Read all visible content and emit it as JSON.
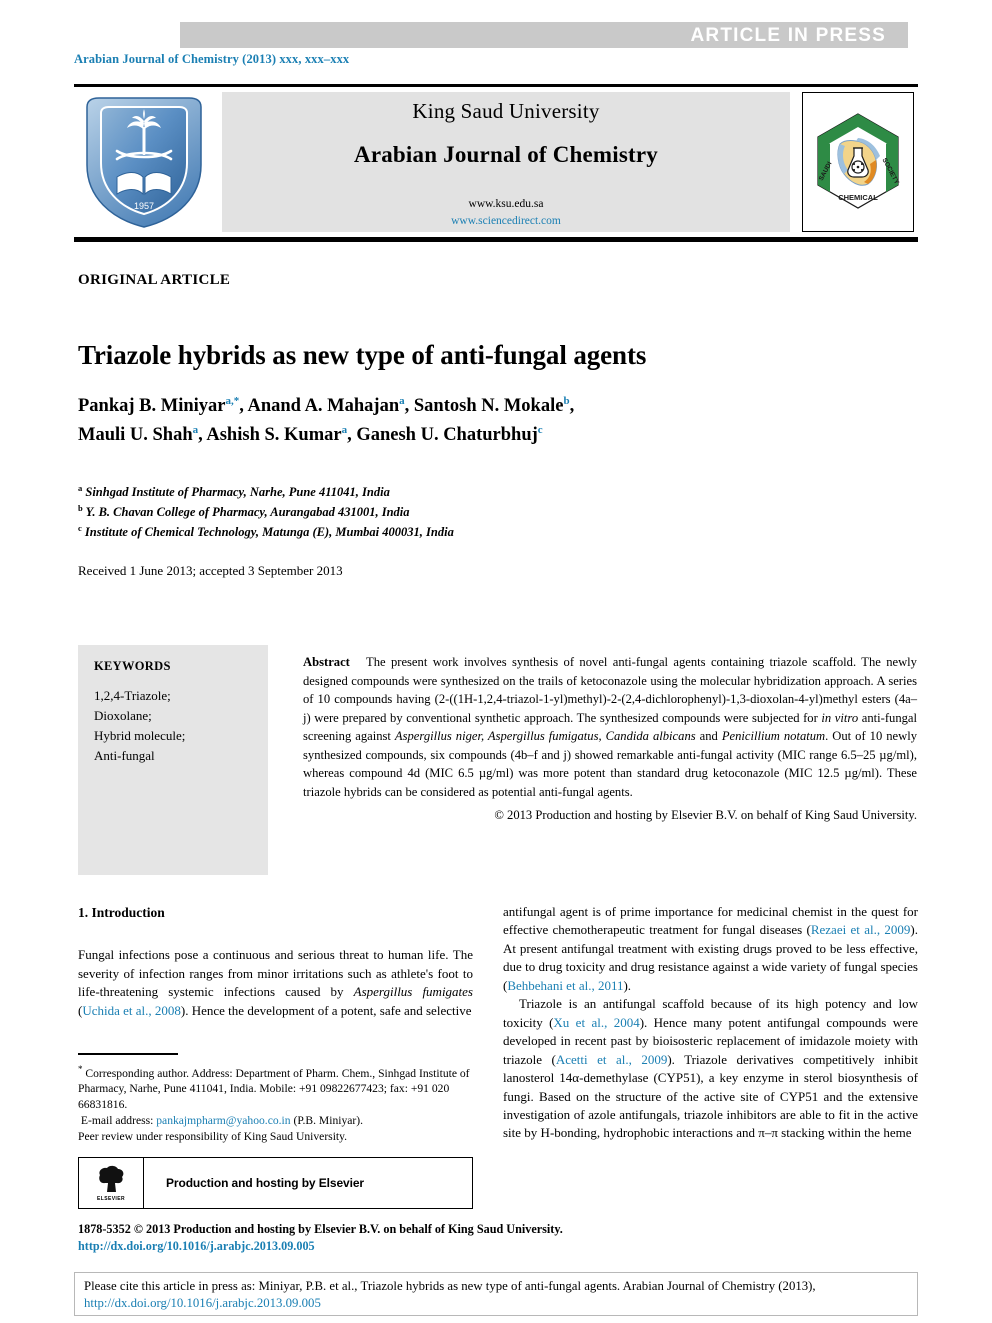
{
  "banner": {
    "text": "ARTICLE  IN  PRESS"
  },
  "journal_ref": "Arabian Journal of Chemistry (2013) xxx, xxx–xxx",
  "masthead": {
    "university": "King Saud University",
    "journal": "Arabian Journal of Chemistry",
    "url_plain": "www.ksu.edu.sa",
    "url_link": "www.sciencedirect.com",
    "left_logo_name": "King Saud University",
    "left_logo_year": "1957",
    "right_logo_top": "CHEMICAL",
    "right_logo_left": "SAUDI",
    "right_logo_right": "SOCIETY"
  },
  "article_type": "ORIGINAL ARTICLE",
  "title": "Triazole hybrids as new type of anti-fungal agents",
  "authors_line_1": "Pankaj B. Miniyar ",
  "authors_line_2": "Mauli U. Shah ",
  "authors": [
    {
      "name": "Pankaj B. Miniyar",
      "marks": "a,*"
    },
    {
      "name": "Anand A. Mahajan",
      "marks": "a"
    },
    {
      "name": "Santosh N. Mokale",
      "marks": "b"
    },
    {
      "name": "Mauli U. Shah",
      "marks": "a"
    },
    {
      "name": "Ashish S. Kumar",
      "marks": "a"
    },
    {
      "name": "Ganesh U. Chaturbhuj",
      "marks": "c"
    }
  ],
  "affiliations": [
    {
      "mark": "a",
      "text": "Sinhgad Institute of Pharmacy, Narhe, Pune 411041, India"
    },
    {
      "mark": "b",
      "text": "Y. B. Chavan College of Pharmacy, Aurangabad 431001, India"
    },
    {
      "mark": "c",
      "text": "Institute of Chemical Technology, Matunga (E), Mumbai 400031, India"
    }
  ],
  "received": "Received 1 June 2013; accepted 3 September 2013",
  "keywords": {
    "heading": "KEYWORDS",
    "items": [
      "1,2,4-Triazole;",
      "Dioxolane;",
      "Hybrid molecule;",
      "Anti-fungal"
    ]
  },
  "abstract": {
    "label": "Abstract",
    "text_1": "The present work involves synthesis of novel anti-fungal agents containing triazole scaffold. The newly designed compounds were synthesized on the trails of ketoconazole using the molecular hybridization approach. A series of 10 compounds having (2-((1H-1,2,4-triazol-1-yl)methyl)-2-(2,4-dichlorophenyl)-1,3-dioxolan-4-yl)methyl esters (4a–j) were prepared by conventional synthetic approach. The synthesized compounds were subjected for ",
    "italic_1": "in vitro",
    "text_2": " anti-fungal screening against ",
    "italic_2": "Aspergillus niger, Aspergillus fumigatus, Candida albicans",
    "text_3": " and ",
    "italic_3": "Penicillium notatum",
    "text_4": ". Out of 10 newly synthesized compounds, six compounds (4b–f and j) showed remarkable anti-fungal activity (MIC range 6.5–25 µg/ml), whereas compound 4d (MIC 6.5 µg/ml) was more potent than standard drug ketoconazole (MIC 12.5 µg/ml). These triazole hybrids can be considered as potential anti-fungal agents.",
    "copyright": "© 2013 Production and hosting by Elsevier B.V. on behalf of King Saud University."
  },
  "body": {
    "section_heading": "1. Introduction",
    "left_p1_a": "Fungal infections pose a continuous and serious threat to human life. The severity of infection ranges from minor irritations such as athlete's foot to life-threatening systemic infections caused by ",
    "left_p1_italic": "Aspergillus fumigates",
    "left_p1_b": " (",
    "left_p1_ref": "Uchida et al., 2008",
    "left_p1_c": "). Hence the development of a potent, safe and selective",
    "right_p1_a": "antifungal agent is of prime importance for medicinal chemist in the quest for effective chemotherapeutic treatment for fungal diseases (",
    "right_p1_ref1": "Rezaei et al., 2009",
    "right_p1_b": "). At present antifungal treatment with existing drugs proved to be less effective, due to drug toxicity and drug resistance against a wide variety of fungal species (",
    "right_p1_ref2": "Behbehani et al., 2011",
    "right_p1_c": ").",
    "right_p2_a": "Triazole is an antifungal scaffold because of its high potency and low toxicity (",
    "right_p2_ref1": "Xu et al., 2004",
    "right_p2_b": "). Hence many potent antifungal compounds were developed in recent past by bioisosteric replacement of imidazole moiety with triazole (",
    "right_p2_ref2": "Acetti et al., 2009",
    "right_p2_c": "). Triazole derivatives competitively inhibit lanosterol 14α-demethylase (CYP51), a key enzyme in sterol biosynthesis of fungi. Based on the structure of the active site of CYP51 and the extensive investigation of azole antifungals, triazole inhibitors are able to fit in the active site by H-bonding, hydrophobic interactions and π–π stacking within the heme"
  },
  "footnote": {
    "star": "*",
    "corresponding": " Corresponding author. Address: Department of Pharm. Chem., Sinhgad Institute of Pharmacy, Narhe, Pune 411041, India. Mobile: +91 09822677423; fax: +91 020 66831816.",
    "email_label": "E-mail address: ",
    "email": "pankajmpharm@yahoo.co.in",
    "email_suffix": " (P.B. Miniyar).",
    "peer_review": "Peer review under responsibility of King Saud University."
  },
  "elsevier_box": {
    "logo_word": "ELSEVIER",
    "caption": "Production and hosting by Elsevier"
  },
  "issn_line": "1878-5352 © 2013 Production and hosting by Elsevier B.V. on behalf of King Saud University.",
  "doi_line": "http://dx.doi.org/10.1016/j.arabjc.2013.09.005",
  "cite_footer": {
    "text_a": "Please cite this article in press as: Miniyar, P.B. et al., Triazole hybrids as new type of anti-fungal agents. Arabian Journal of Chemistry (2013), ",
    "doi": "http://dx.doi.org/10.1016/j.arabjc.2013.09.005"
  },
  "colors": {
    "link": "#1a7fb3",
    "banner_bg": "#c9c9c9",
    "masthead_bg": "#e2e2e2",
    "keywords_bg": "#e5e5e5"
  }
}
